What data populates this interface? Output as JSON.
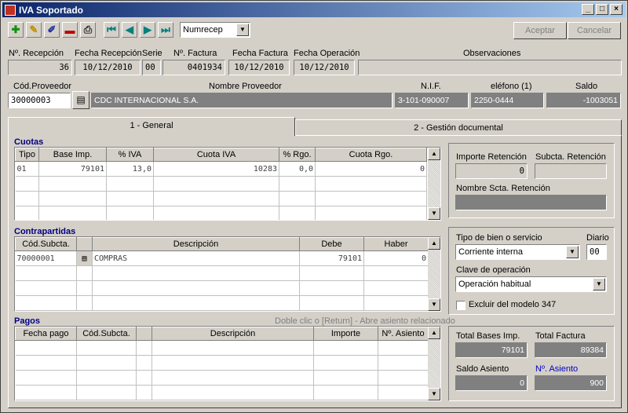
{
  "window": {
    "title": "IVA Soportado"
  },
  "toolbar": {
    "combo_value": "Numrecep",
    "accept_label": "Aceptar",
    "cancel_label": "Cancelar"
  },
  "header": {
    "labels": {
      "recepcion": "Nº. Recepción",
      "fecha_recepcion": "Fecha Recepción",
      "serie": "Serie",
      "factura": "Nº. Factura",
      "fecha_factura": "Fecha Factura",
      "fecha_operacion": "Fecha Operación",
      "observaciones": "Observaciones"
    },
    "values": {
      "recepcion": "36",
      "fecha_recepcion": "10/12/2010",
      "serie": "00",
      "factura": "0401934",
      "fecha_factura": "10/12/2010",
      "fecha_operacion": "10/12/2010",
      "observaciones": ""
    }
  },
  "proveedor": {
    "labels": {
      "codigo": "Cód.Proveedor",
      "nombre": "Nombre Proveedor",
      "nif": "N.I.F.",
      "telefono": "eléfono (1)",
      "saldo": "Saldo"
    },
    "values": {
      "codigo": "30000003",
      "nombre": "CDC INTERNACIONAL S.A.",
      "nif": "3-101-090007",
      "telefono": "2250-0444",
      "saldo": "-1003051"
    }
  },
  "tabs": [
    {
      "label": "1 - General"
    },
    {
      "label": "2 - Gestión documental"
    }
  ],
  "cuotas": {
    "title": "Cuotas",
    "headers": [
      "Tipo",
      "Base Imp.",
      "% IVA",
      "Cuota IVA",
      "% Rgo.",
      "Cuota Rgo."
    ],
    "rows": [
      [
        "01",
        "79101",
        "13,0",
        "10283",
        "0,0",
        "0"
      ]
    ]
  },
  "contrapartidas": {
    "title": "Contrapartidas",
    "headers": [
      "Cód.Subcta.",
      "",
      "Descripción",
      "Debe",
      "Haber"
    ],
    "rows": [
      [
        "70000001",
        "",
        "COMPRAS",
        "79101",
        "0"
      ]
    ]
  },
  "pagos": {
    "title": "Pagos",
    "hint": "Doble clic o [Return] - Abre asiento relacionado",
    "headers": [
      "Fecha pago",
      "Cód.Subcta.",
      "",
      "Descripción",
      "Importe",
      "Nº. Asiento"
    ]
  },
  "retencion": {
    "importe_label": "Importe Retención",
    "importe_value": "0",
    "subcta_label": "Subcta. Retención",
    "subcta_value": "",
    "nombre_label": "Nombre Scta. Retención",
    "nombre_value": ""
  },
  "clasificacion": {
    "tipo_label": "Tipo de bien o servicio",
    "tipo_value": "Corriente interna",
    "diario_label": "Diario",
    "diario_value": "00",
    "clave_label": "Clave de operación",
    "clave_value": "Operación habitual",
    "excluir_label": "Excluir del modelo 347"
  },
  "totales": {
    "bases_label": "Total Bases Imp.",
    "bases_value": "79101",
    "factura_label": "Total Factura",
    "factura_value": "89384",
    "saldo_label": "Saldo Asiento",
    "saldo_value": "0",
    "asiento_label": "Nº. Asiento",
    "asiento_value": "900"
  },
  "colors": {
    "accent": "#0a246a",
    "section_title": "#00007f",
    "dark_field": "#808080"
  }
}
